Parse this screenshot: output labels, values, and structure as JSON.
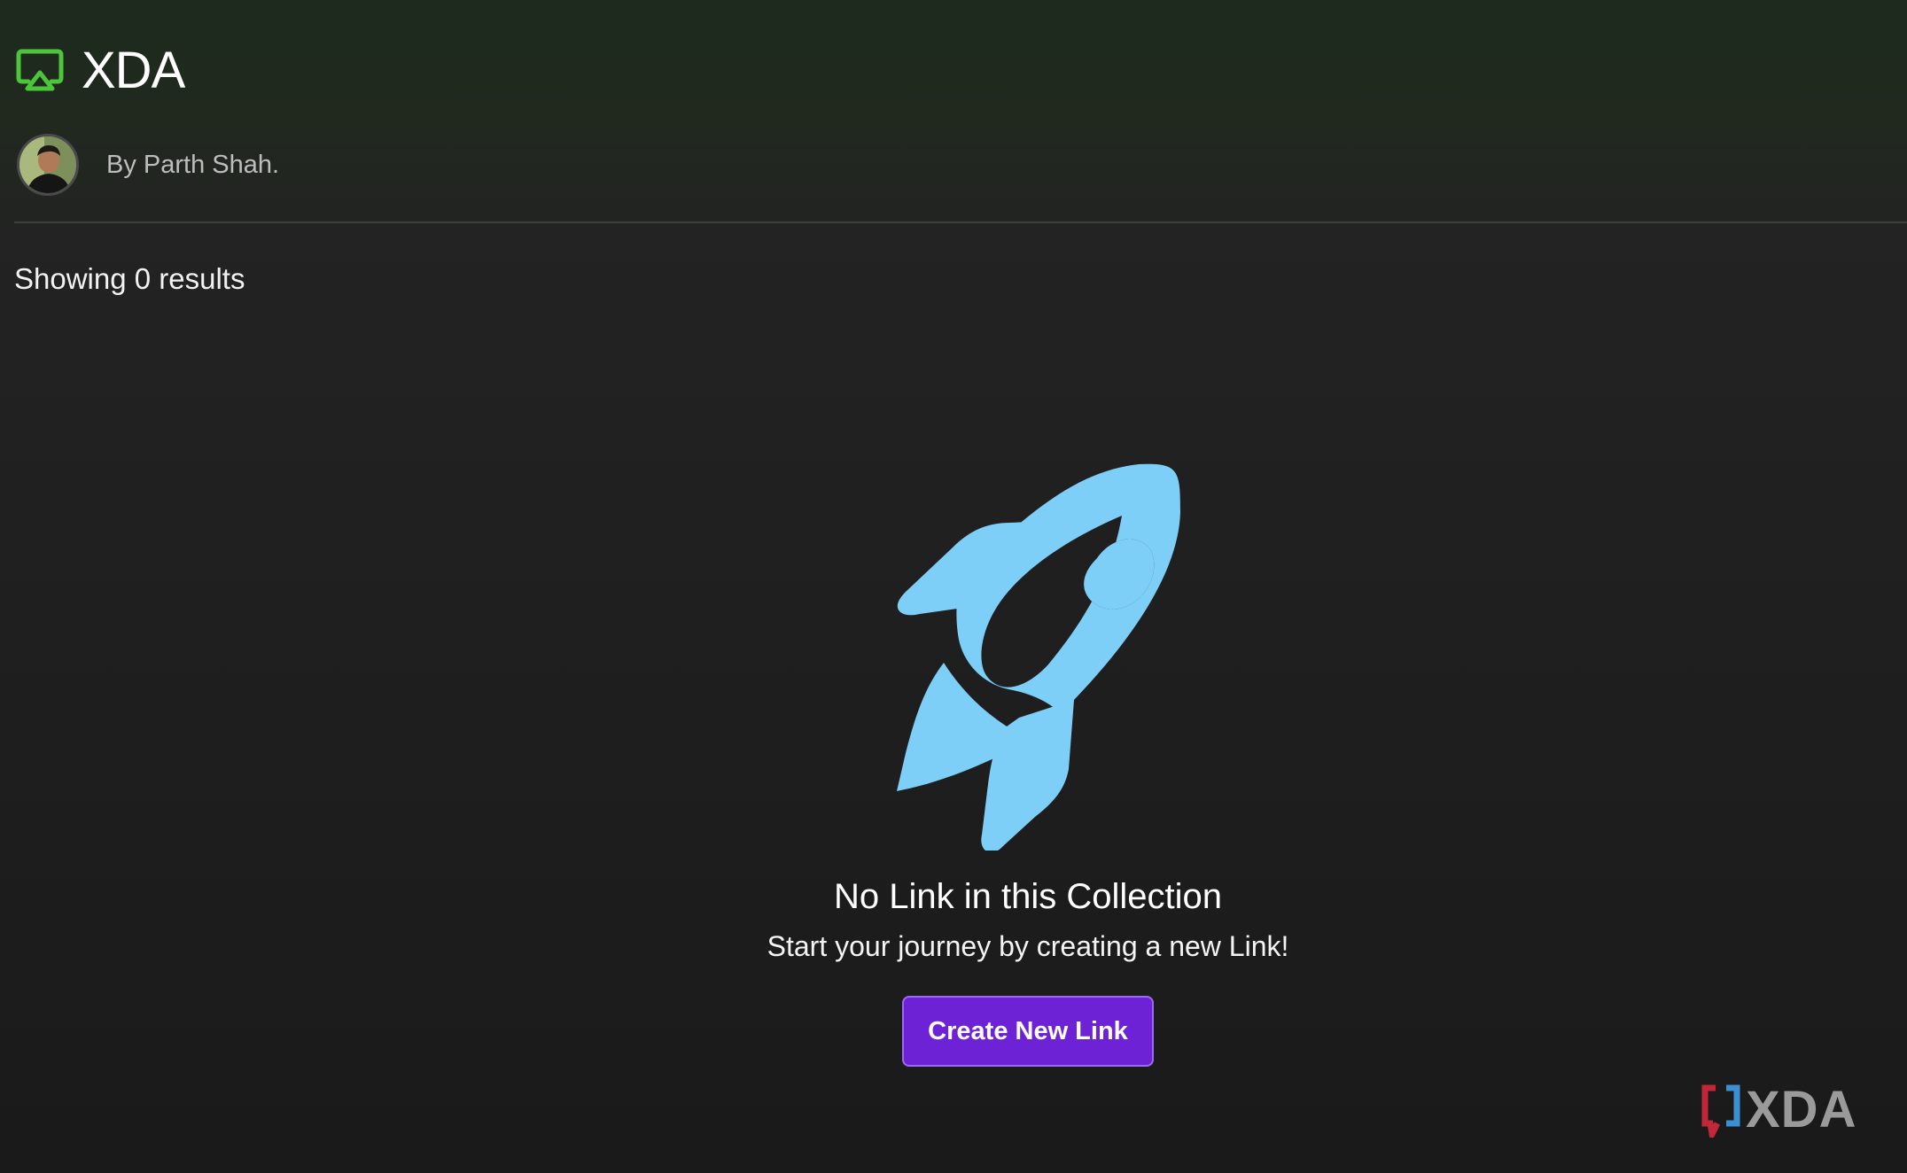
{
  "collection": {
    "title": "XDA",
    "icon": "airplay-icon",
    "accent_color": "#4bc63a"
  },
  "author": {
    "byline": "By Parth Shah."
  },
  "results": {
    "count_text": "Showing 0 results"
  },
  "empty_state": {
    "icon": "rocket-icon",
    "icon_color": "#7dcff8",
    "title": "No Link in this Collection",
    "subtitle": "Start your journey by creating a new Link!",
    "button_label": "Create New Link",
    "button_color": "#6d22d6"
  },
  "watermark": {
    "text": "XDA"
  }
}
